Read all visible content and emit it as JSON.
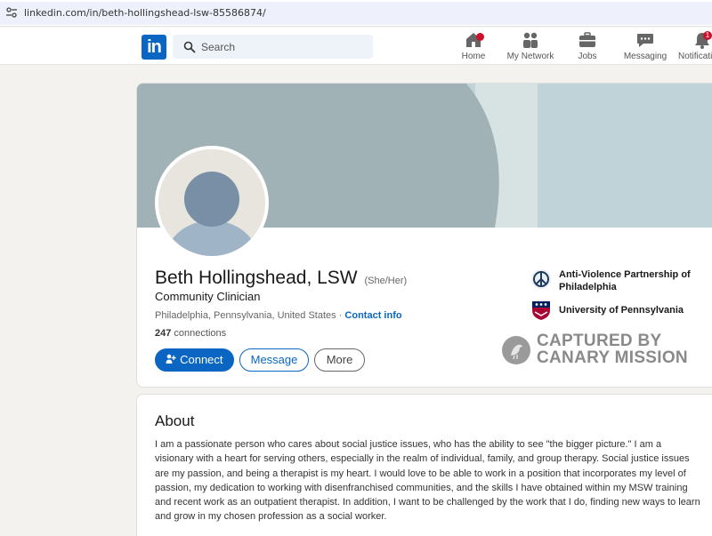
{
  "browser": {
    "url": "linkedin.com/in/beth-hollingshead-lsw-85586874/"
  },
  "nav": {
    "logo": "in",
    "search_placeholder": "Search",
    "items": [
      {
        "label": "Home",
        "icon": "home-icon",
        "badge": ""
      },
      {
        "label": "My Network",
        "icon": "people-icon",
        "badge": ""
      },
      {
        "label": "Jobs",
        "icon": "briefcase-icon",
        "badge": ""
      },
      {
        "label": "Messaging",
        "icon": "chat-icon",
        "badge": ""
      },
      {
        "label": "Notificati",
        "icon": "bell-icon",
        "badge": "1"
      }
    ]
  },
  "profile": {
    "name": "Beth Hollingshead, LSW",
    "pronouns": "(She/Her)",
    "headline": "Community Clinician",
    "location": "Philadelphia, Pennsylvania, United States",
    "separator": " · ",
    "contact_info": "Contact info",
    "connections_count": "247",
    "connections_label": " connections",
    "buttons": {
      "connect": "Connect",
      "message": "Message",
      "more": "More"
    },
    "orgs": [
      {
        "name": "Anti-Violence Partnership of Philadelphia",
        "icon": "peace-sign-icon"
      },
      {
        "name": "University of Pennsylvania",
        "icon": "penn-shield-icon"
      }
    ]
  },
  "watermark": {
    "line1": "CAPTURED BY",
    "line2": "CANARY MISSION"
  },
  "about": {
    "title": "About",
    "text": "I am a passionate person who cares about social justice issues, who has the ability to see \"the bigger picture.\" I am a visionary with a heart for serving others, especially in the realm of individual, family, and group therapy. Social justice issues are my passion, and being a therapist is my heart. I would love to be able to work in a position that incorporates my level of passion, my dedication to working with disenfranchised communities, and the skills I have obtained within my MSW training and recent work as an outpatient therapist. In addition, I want to be challenged by the work that I do, finding new ways to learn and grow in my chosen profession as a social worker."
  },
  "colors": {
    "brand": "#0a66c2",
    "badge": "#cb112d",
    "page_bg": "#f4f2ee"
  }
}
